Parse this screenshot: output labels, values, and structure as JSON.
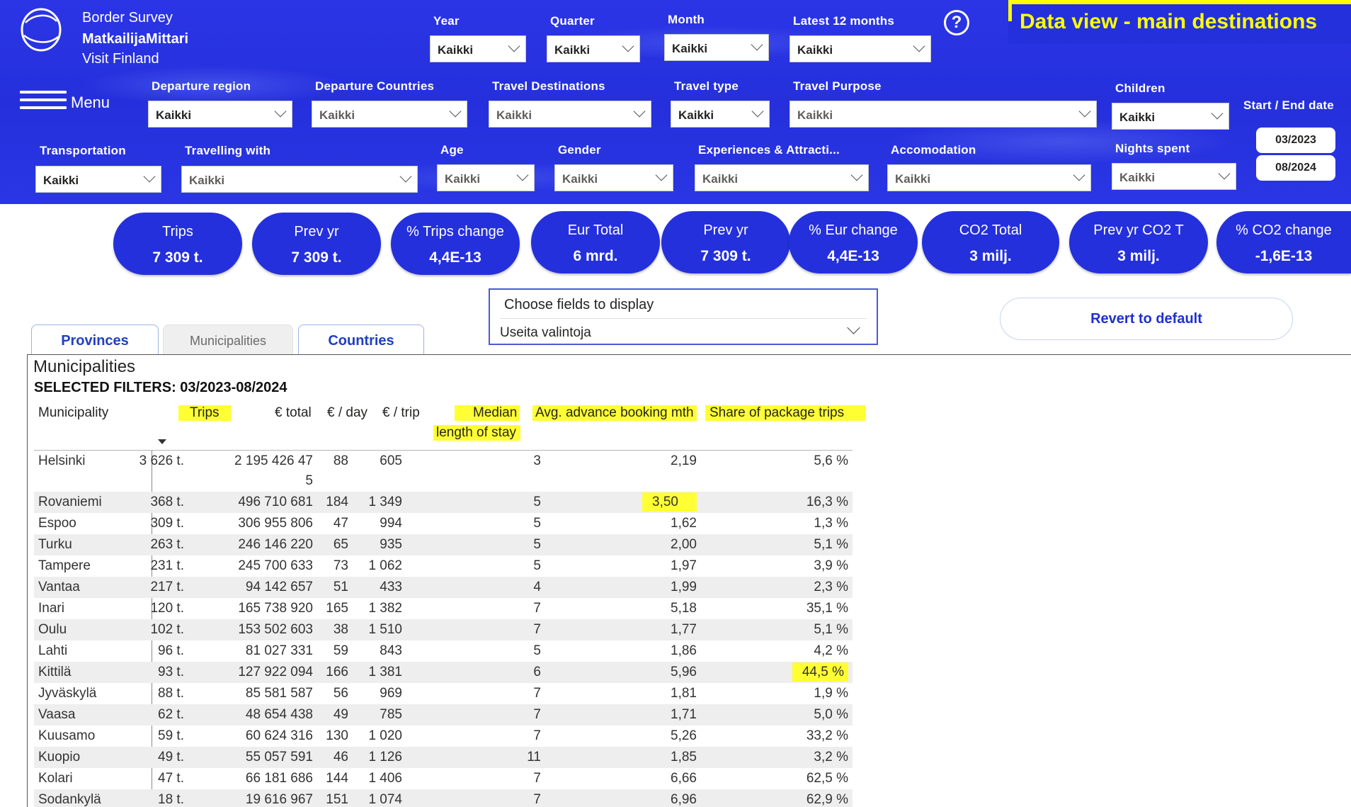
{
  "header": {
    "brand_line1": "Border Survey",
    "brand_line2": "MatkailijaMittari",
    "brand_line3": "Visit Finland",
    "data_view_title": "Data view  - main destinations",
    "help_icon": "?",
    "menu_label": "Menu",
    "date_label": "Start / End date",
    "start_date": "03/2023",
    "end_date": "08/2024"
  },
  "filters": [
    {
      "label": "Year",
      "value": "Kaikki"
    },
    {
      "label": "Quarter",
      "value": "Kaikki"
    },
    {
      "label": "Month",
      "value": "Kaikki"
    },
    {
      "label": "Latest 12 months",
      "value": "Kaikki"
    },
    {
      "label": "Departure region",
      "value": "Kaikki"
    },
    {
      "label": "Departure Countries",
      "value": "Kaikki"
    },
    {
      "label": "Travel Destinations",
      "value": "Kaikki"
    },
    {
      "label": "Travel type",
      "value": "Kaikki"
    },
    {
      "label": "Travel Purpose",
      "value": "Kaikki"
    },
    {
      "label": "Children",
      "value": "Kaikki"
    },
    {
      "label": "Transportation",
      "value": "Kaikki"
    },
    {
      "label": "Travelling with",
      "value": "Kaikki"
    },
    {
      "label": "Age",
      "value": "Kaikki"
    },
    {
      "label": "Gender",
      "value": "Kaikki"
    },
    {
      "label": "Experiences & Attracti...",
      "value": "Kaikki"
    },
    {
      "label": "Accomodation",
      "value": "Kaikki"
    },
    {
      "label": "Nights spent",
      "value": "Kaikki"
    }
  ],
  "kpis": [
    {
      "title": "Trips",
      "value": "7 309 t."
    },
    {
      "title": "Prev yr",
      "value": "7 309 t."
    },
    {
      "title": "% Trips change",
      "value": "4,4E-13"
    },
    {
      "title": "Eur Total",
      "value": "6 mrd."
    },
    {
      "title": "Prev yr",
      "value": "7 309 t."
    },
    {
      "title": "% Eur change",
      "value": "4,4E-13"
    },
    {
      "title": "CO2 Total",
      "value": "3 milj."
    },
    {
      "title": "Prev yr CO2 T",
      "value": "3 milj."
    },
    {
      "title": "% CO2 change",
      "value": "-1,6E-13"
    }
  ],
  "chooser": {
    "caption": "Choose fields to display",
    "value": "Useita valintoja"
  },
  "revert_label": "Revert to default",
  "tabs": [
    {
      "label": "Provinces"
    },
    {
      "label": "Municipalities"
    },
    {
      "label": "Countries"
    }
  ],
  "table": {
    "title": "Municipalities",
    "selected_filters": "SELECTED FILTERS: 03/2023-08/2024",
    "columns": {
      "municipality": "Municipality",
      "trips": "Trips",
      "total": "€ total",
      "per_day": "€ / day",
      "per_trip": "€ / trip",
      "median_a": "Median",
      "median_b": "length of stay",
      "advance": "Avg. advance booking mth",
      "package": "Share of package trips"
    },
    "rows": [
      {
        "name": "Helsinki",
        "trips": "3 626 t.",
        "total": "2 195 426 47",
        "total_wrap": "5",
        "day": "88",
        "trip": "605",
        "median": "3",
        "adv": "2,19",
        "pkg": "5,6 %"
      },
      {
        "name": "Rovaniemi",
        "trips": "368 t.",
        "total": "496 710 681",
        "day": "184",
        "trip": "1 349",
        "median": "5",
        "adv": "3,50",
        "pkg": "16,3 %"
      },
      {
        "name": "Espoo",
        "trips": "309 t.",
        "total": "306 955 806",
        "day": "47",
        "trip": "994",
        "median": "5",
        "adv": "1,62",
        "pkg": "1,3 %"
      },
      {
        "name": "Turku",
        "trips": "263 t.",
        "total": "246 146 220",
        "day": "65",
        "trip": "935",
        "median": "5",
        "adv": "2,00",
        "pkg": "5,1 %"
      },
      {
        "name": "Tampere",
        "trips": "231 t.",
        "total": "245 700 633",
        "day": "73",
        "trip": "1 062",
        "median": "5",
        "adv": "1,97",
        "pkg": "3,9 %"
      },
      {
        "name": "Vantaa",
        "trips": "217 t.",
        "total": "94 142 657",
        "day": "51",
        "trip": "433",
        "median": "4",
        "adv": "1,99",
        "pkg": "2,3 %"
      },
      {
        "name": "Inari",
        "trips": "120 t.",
        "total": "165 738 920",
        "day": "165",
        "trip": "1 382",
        "median": "7",
        "adv": "5,18",
        "pkg": "35,1 %"
      },
      {
        "name": "Oulu",
        "trips": "102 t.",
        "total": "153 502 603",
        "day": "38",
        "trip": "1 510",
        "median": "7",
        "adv": "1,77",
        "pkg": "5,1 %"
      },
      {
        "name": "Lahti",
        "trips": "96 t.",
        "total": "81 027 331",
        "day": "59",
        "trip": "843",
        "median": "5",
        "adv": "1,86",
        "pkg": "4,2 %"
      },
      {
        "name": "Kittilä",
        "trips": "93 t.",
        "total": "127 922 094",
        "day": "166",
        "trip": "1 381",
        "median": "6",
        "adv": "5,96",
        "pkg": "44,5 %"
      },
      {
        "name": "Jyväskylä",
        "trips": "88 t.",
        "total": "85 581 587",
        "day": "56",
        "trip": "969",
        "median": "7",
        "adv": "1,81",
        "pkg": "1,9 %"
      },
      {
        "name": "Vaasa",
        "trips": "62 t.",
        "total": "48 654 438",
        "day": "49",
        "trip": "785",
        "median": "7",
        "adv": "1,71",
        "pkg": "5,0 %"
      },
      {
        "name": "Kuusamo",
        "trips": "59 t.",
        "total": "60 624 316",
        "day": "130",
        "trip": "1 020",
        "median": "7",
        "adv": "5,26",
        "pkg": "33,2 %"
      },
      {
        "name": "Kuopio",
        "trips": "49 t.",
        "total": "55 057 591",
        "day": "46",
        "trip": "1 126",
        "median": "11",
        "adv": "1,85",
        "pkg": "3,2 %"
      },
      {
        "name": "Kolari",
        "trips": "47 t.",
        "total": "66 181 686",
        "day": "144",
        "trip": "1 406",
        "median": "7",
        "adv": "6,66",
        "pkg": "62,5 %"
      },
      {
        "name": "Sodankylä",
        "trips": "18 t.",
        "total": "19 616 967",
        "day": "151",
        "trip": "1 074",
        "median": "7",
        "adv": "6,96",
        "pkg": "62,9 %"
      }
    ]
  }
}
